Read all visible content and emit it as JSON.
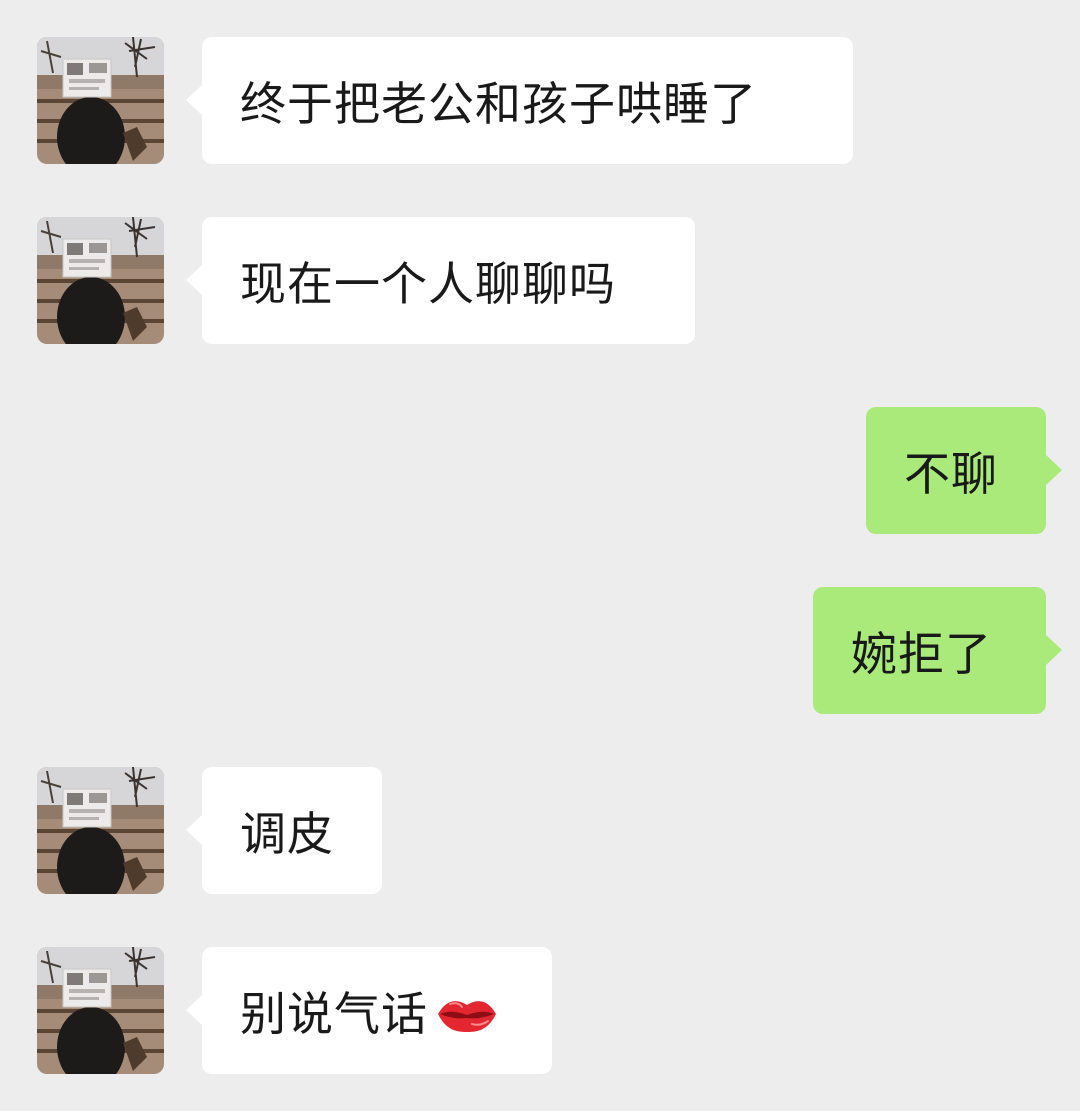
{
  "colors": {
    "background": "#ededed",
    "incoming_bubble": "#ffffff",
    "outgoing_bubble": "#a9ea7a",
    "text": "#191919"
  },
  "messages": [
    {
      "side": "in",
      "text": "终于把老公和孩子哄睡了"
    },
    {
      "side": "in",
      "text": "现在一个人聊聊吗"
    },
    {
      "side": "out",
      "text": "不聊"
    },
    {
      "side": "out",
      "text": "婉拒了"
    },
    {
      "side": "in",
      "text": "调皮"
    },
    {
      "side": "in",
      "text": "别说气话",
      "emoji": "lips-emoji"
    }
  ]
}
